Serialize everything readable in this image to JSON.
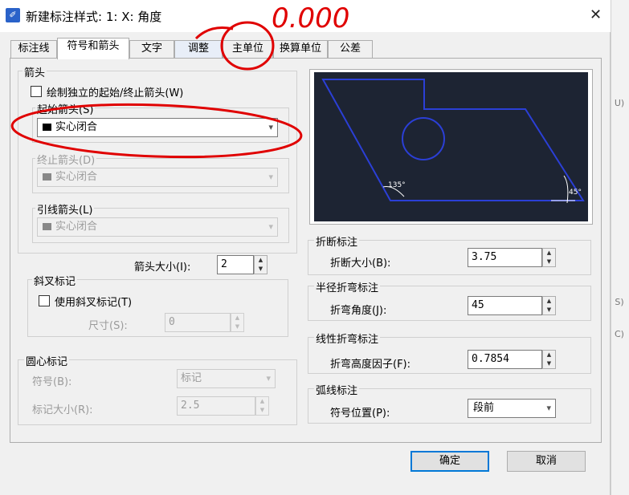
{
  "window": {
    "title": "新建标注样式: 1: X: 角度",
    "close": "✕"
  },
  "tabs": [
    "标注线",
    "符号和箭头",
    "文字",
    "调整",
    "主单位",
    "换算单位",
    "公差"
  ],
  "arrowheads": {
    "group_label": "箭头",
    "draw_independent_label": "绘制独立的起始/终止箭头(W)",
    "first_label": "起始箭头(S)",
    "first_value": "实心闭合",
    "second_label": "终止箭头(D)",
    "second_value": "实心闭合",
    "leader_label": "引线箭头(L)",
    "leader_value": "实心闭合",
    "size_label": "箭头大小(I):",
    "size_value": "2"
  },
  "oblique": {
    "group_label": "斜叉标记",
    "use_label": "使用斜叉标记(T)",
    "size_label": "尺寸(S):",
    "size_value": "0"
  },
  "center_marks": {
    "group_label": "圆心标记",
    "symbol_label": "符号(B):",
    "symbol_value": "标记",
    "size_label": "标记大小(R):",
    "size_value": "2.5"
  },
  "break": {
    "group_label": "折断标注",
    "size_label": "折断大小(B):",
    "size_value": "3.75"
  },
  "radius_jog": {
    "group_label": "半径折弯标注",
    "angle_label": "折弯角度(J):",
    "angle_value": "45"
  },
  "linear_jog": {
    "group_label": "线性折弯标注",
    "factor_label": "折弯高度因子(F):",
    "factor_value": "0.7854"
  },
  "arc_length": {
    "group_label": "弧线标注",
    "position_label": "符号位置(P):",
    "position_value": "段前"
  },
  "preview_labels": {
    "left_angle": "135°",
    "right_angle": "45°"
  },
  "buttons": {
    "ok": "确定",
    "cancel": "取消"
  },
  "annotation": {
    "handwritten": "0.000"
  },
  "right_strip": [
    "U)",
    "S)",
    "C)"
  ],
  "colors": {
    "preview_bg": "#1d2433",
    "preview_stroke": "#2b3fd6",
    "annotation_red": "#e00000",
    "accent": "#0078d7"
  }
}
